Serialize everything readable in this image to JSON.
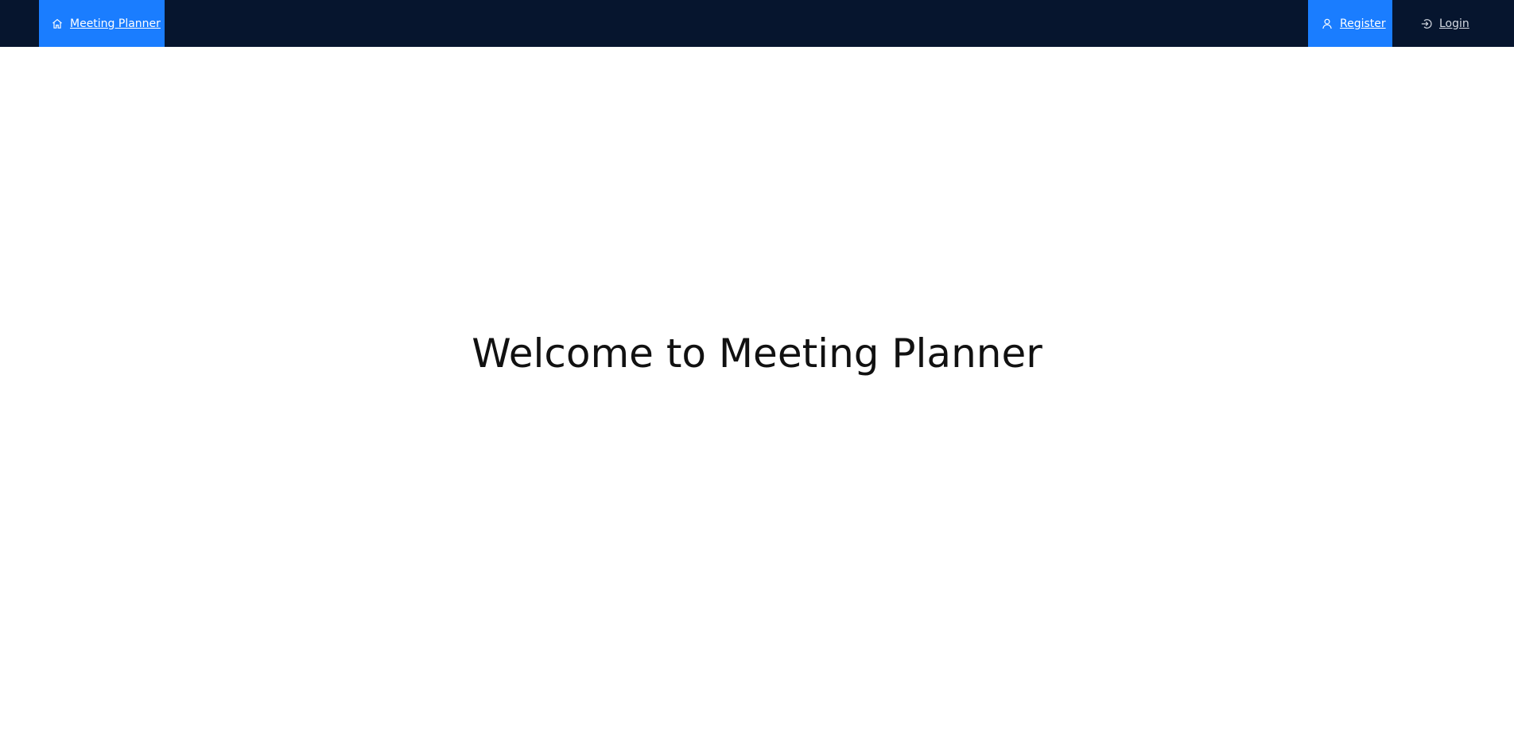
{
  "nav": {
    "home": {
      "label": "Meeting Planner",
      "icon": "home-icon"
    },
    "register": {
      "label": "Register",
      "icon": "user-icon"
    },
    "login": {
      "label": "Login",
      "icon": "login-icon"
    }
  },
  "main": {
    "heading": "Welcome to Meeting Planner"
  },
  "colors": {
    "topbar": "#06152e",
    "accent": "#1a7dff",
    "heading": "#111111"
  }
}
